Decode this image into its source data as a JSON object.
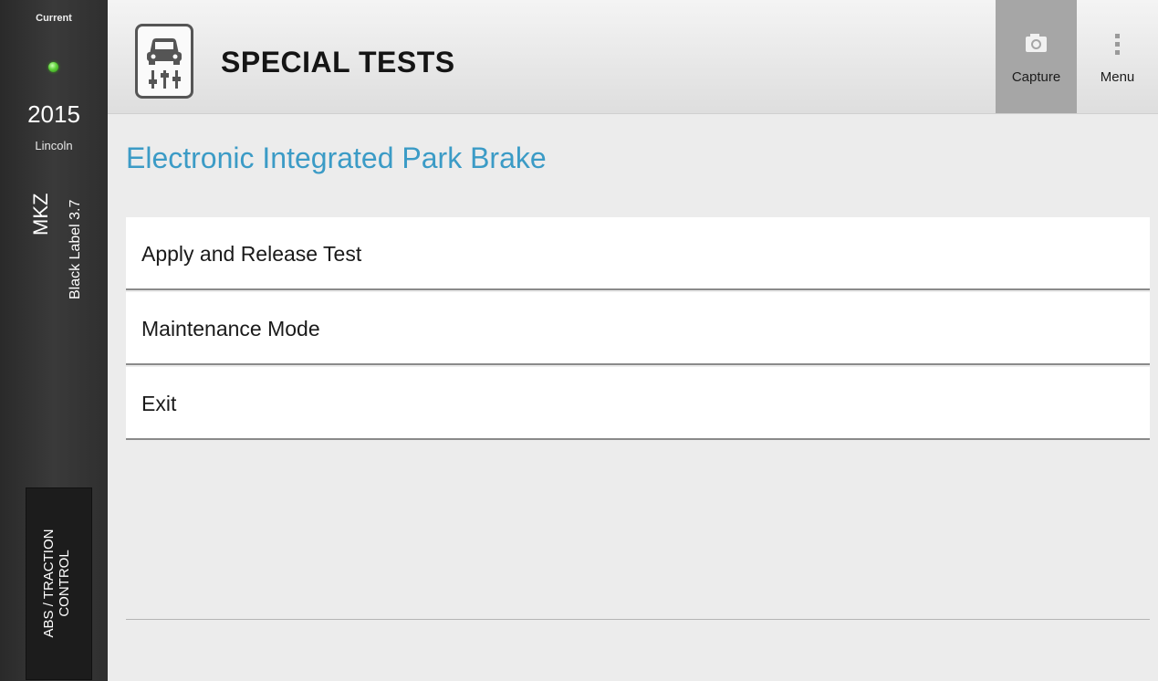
{
  "sidebar": {
    "status_label": "Current",
    "status_color": "#5fd23a",
    "year": "2015",
    "make": "Lincoln",
    "model": "MKZ",
    "trim": "Black Label 3.7",
    "module_label_line1": "ABS / TRACTION",
    "module_label_line2": "CONTROL"
  },
  "header": {
    "app_icon": "car-sliders-icon",
    "title": "SPECIAL TESTS",
    "capture_icon": "camera-icon",
    "capture_label": "Capture",
    "menu_icon": "vertical-dots-icon",
    "menu_label": "Menu"
  },
  "main": {
    "section_title": "Electronic Integrated Park Brake",
    "title_color": "#3b9bc6",
    "items": [
      {
        "label": "Apply and Release Test"
      },
      {
        "label": "Maintenance Mode"
      },
      {
        "label": "Exit"
      }
    ]
  }
}
